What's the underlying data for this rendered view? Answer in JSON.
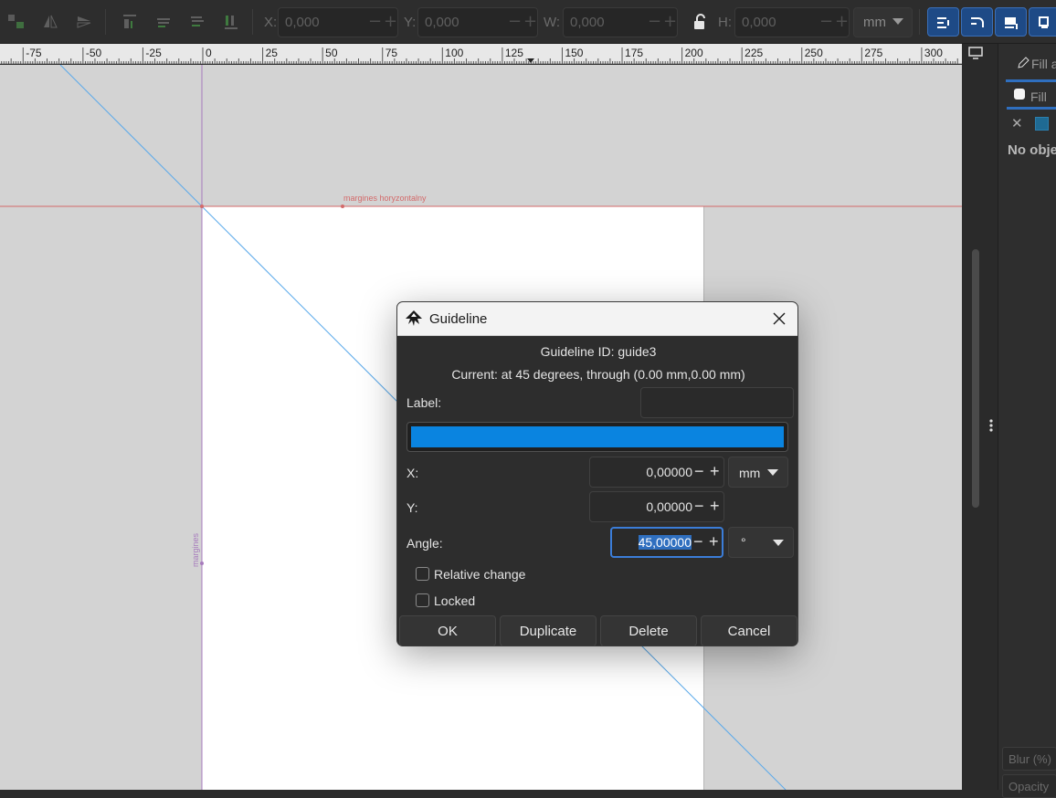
{
  "toolbar": {
    "x_label": "X:",
    "x_value": "0,000",
    "y_label": "Y:",
    "y_value": "0,000",
    "w_label": "W:",
    "w_value": "0,000",
    "h_label": "H:",
    "h_value": "0,000",
    "unit": "mm",
    "minus": "−",
    "plus": "+",
    "icons": [
      "select-same-icon",
      "flip-horizontal-icon",
      "flip-vertical-icon",
      "raise-to-top-icon",
      "raise-icon",
      "lower-icon",
      "lower-to-bottom-icon",
      "lock-icon"
    ]
  },
  "ruler": {
    "labels": [
      "-75",
      "-50",
      "-25",
      "0",
      "25",
      "50",
      "75",
      "100",
      "125",
      "150",
      "175",
      "200",
      "225",
      "250",
      "275",
      "300"
    ]
  },
  "canvas": {
    "guide_horizontal_label": "margines horyzontalny",
    "guide_vertical_label": "margines",
    "colors": {
      "guide_red": "#d36a6a",
      "guide_purple": "#a77bbd",
      "guide_blue": "#5aa9ea"
    }
  },
  "dock": {
    "tab_label": "Fill a",
    "fill_tab": "Fill",
    "no_objects": "No obje",
    "blur_label": "Blur (%)",
    "opacity_label": "Opacity"
  },
  "dialog": {
    "title": "Guideline",
    "guide_id": "Guideline ID: guide3",
    "current": "Current: at 45 degrees, through (0.00 mm,0.00 mm)",
    "label_caption": "Label:",
    "label_value": "",
    "color": "#0a84e0",
    "x_caption": "X:",
    "x_value": "0,00000",
    "y_caption": "Y:",
    "y_value": "0,00000",
    "angle_caption": "Angle:",
    "angle_value": "45,00000",
    "unit": "mm",
    "angle_unit": "°",
    "relative_change": "Relative change",
    "locked": "Locked",
    "buttons": {
      "ok": "OK",
      "duplicate": "Duplicate",
      "delete": "Delete",
      "cancel": "Cancel"
    }
  }
}
